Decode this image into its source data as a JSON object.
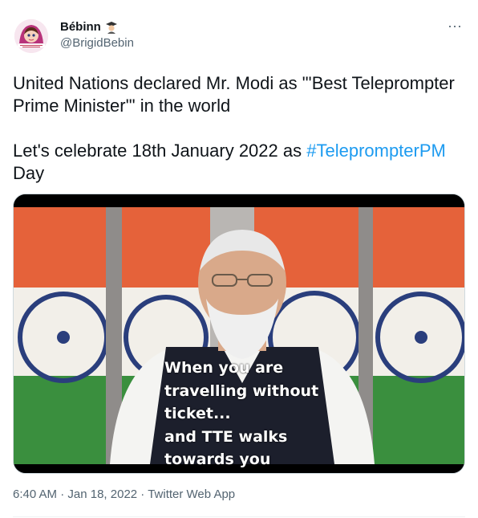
{
  "tweet": {
    "display_name": "Bébinn",
    "handle": "@BrigidBebin",
    "more_label": "···",
    "text_line_1": "United Nations declared Mr. Modi as \"'Best Teleprompter Prime Minister'\" in the world",
    "text_line_2_prefix": "Let's celebrate 18th January 2022 as ",
    "hashtag": "#TeleprompterPM",
    "text_line_2_suffix": " Day",
    "time": "6:40 AM",
    "separator": " · ",
    "date": "Jan 18, 2022",
    "source": "Twitter Web App"
  },
  "media": {
    "caption_lines": [
      "When you are",
      "travelling without",
      "ticket...",
      "and TTE walks",
      "towards you"
    ]
  },
  "icons": {
    "avatar": "avatar-cartoon-girl",
    "badge": "graduate-emoji-icon",
    "more": "more-dots-icon"
  },
  "colors": {
    "hashtag": "#1d9bf0",
    "secondary_text": "#536471",
    "primary_text": "#0f1419",
    "saffron": "#e5623a",
    "green": "#3a8f3e",
    "chakra": "#2a3e7c"
  }
}
